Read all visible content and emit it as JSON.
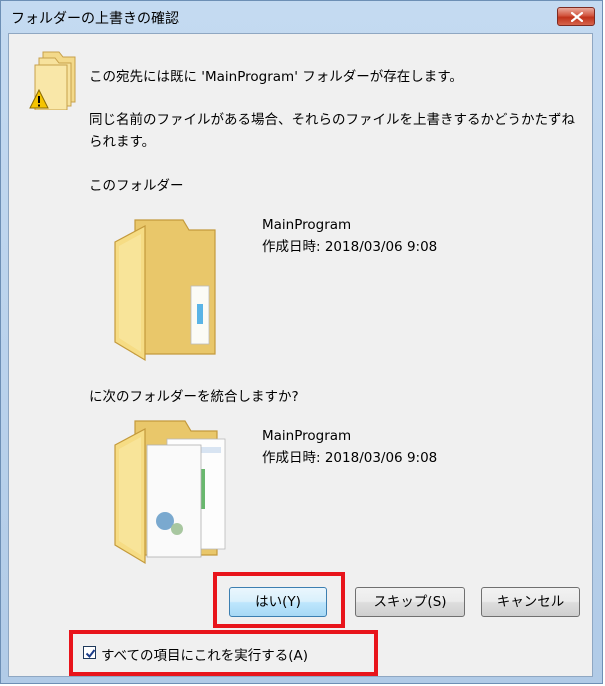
{
  "window": {
    "title": "フォルダーの上書きの確認"
  },
  "message": {
    "line1": "この宛先には既に 'MainProgram' フォルダーが存在します。",
    "line2": "同じ名前のファイルがある場合、それらのファイルを上書きするかどうかたずねられます。"
  },
  "existing": {
    "label": "このフォルダー",
    "name": "MainProgram",
    "created": "作成日時: 2018/03/06 9:08"
  },
  "incoming": {
    "label": "に次のフォルダーを統合しますか?",
    "name": "MainProgram",
    "created": "作成日時: 2018/03/06 9:08"
  },
  "buttons": {
    "yes": "はい(Y)",
    "skip": "スキップ(S)",
    "cancel": "キャンセル"
  },
  "checkbox": {
    "label": "すべての項目にこれを実行する(A)",
    "checked": true
  },
  "icons": {
    "warning": "warning-folder-icon",
    "close": "close-icon",
    "folder": "folder-icon",
    "folder_with_docs": "folder-with-documents-icon"
  },
  "colors": {
    "highlight": "#e8141b",
    "titlebar": "#c4daf1",
    "close_button": "#c0331b",
    "folder": "#f5dd82"
  }
}
